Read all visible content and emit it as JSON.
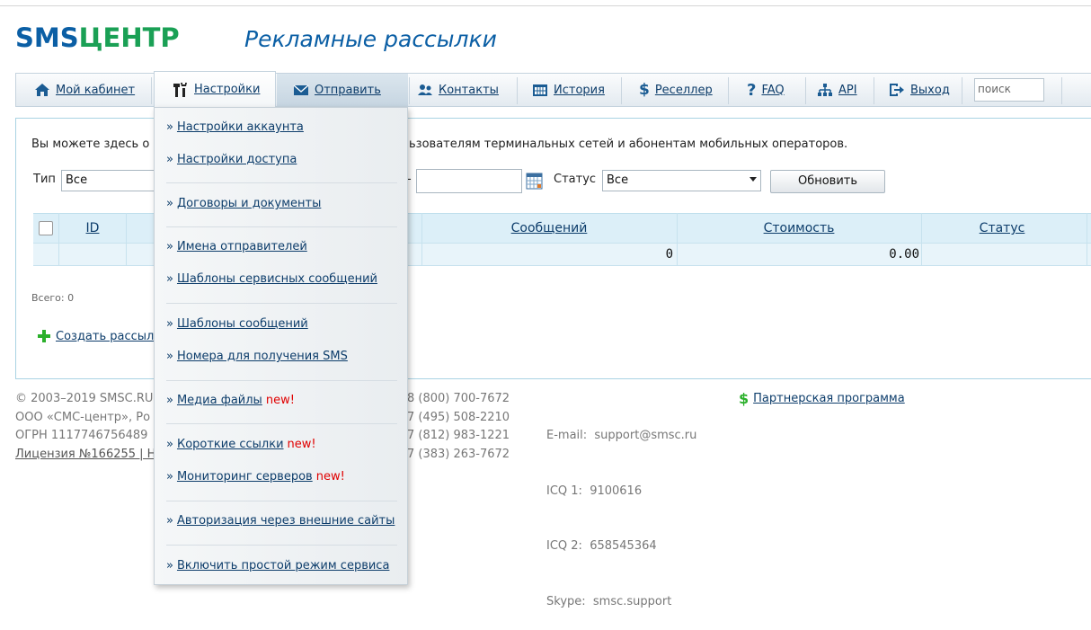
{
  "logo": {
    "part1": "SMS",
    "part2": "ЦЕНТР"
  },
  "page_title": "Рекламные рассылки",
  "nav": {
    "items": [
      {
        "label": "Мой кабинет",
        "icon": "home-icon"
      },
      {
        "label": "Настройки",
        "icon": "tools-icon"
      },
      {
        "label": "Отправить",
        "icon": "envelope-icon"
      },
      {
        "label": "Контакты",
        "icon": "contacts-icon"
      },
      {
        "label": "История",
        "icon": "calendar-icon"
      },
      {
        "label": "Реселлер",
        "icon": "dollar-icon"
      },
      {
        "label": "FAQ",
        "icon": "question-icon"
      },
      {
        "label": "API",
        "icon": "sitemap-icon"
      },
      {
        "label": "Выход",
        "icon": "exit-icon"
      }
    ],
    "search_placeholder": "поиск"
  },
  "main": {
    "intro_left": "Вы можете здесь о",
    "intro_right": "ьзователям терминальных сетей и абонентам мобильных операторов.",
    "filter_type_label": "Тип",
    "filter_type_value": "Все",
    "filter_dash": "-",
    "filter_status_label": "Статус",
    "filter_status_value": "Все",
    "refresh_button": "Обновить",
    "table": {
      "headers": [
        "ID",
        "Сообщений",
        "Стоимость",
        "Статус"
      ],
      "row": {
        "messages": "0",
        "cost": "0.00"
      }
    },
    "total": "Всего: 0",
    "create_link": "Создать рассыл"
  },
  "footer": {
    "col1": [
      "© 2003–2019 SMSC.RU",
      "ООО «СМС-центр», Ро",
      "ОГРН 1117746756489",
      "Лицензия №166255 | Н"
    ],
    "col2": [
      "8 (800) 700-7672",
      "7 (495) 508-2210",
      "7 (812) 983-1221",
      "7 (383) 263-7672"
    ],
    "col3": [
      "E-mail:  support@smsc.ru",
      "ICQ 1:  9100616",
      "ICQ 2:  658545364",
      "Skype:  smsc.support"
    ],
    "partner_link": "Партнерская программа"
  },
  "dropdown": {
    "items": [
      {
        "label": "Настройки аккаунта",
        "new": ""
      },
      {
        "label": "Настройки доступа",
        "new": ""
      },
      {
        "label": "Договоры и документы",
        "new": ""
      },
      {
        "label": "Имена отправителей",
        "new": ""
      },
      {
        "label": "Шаблоны сервисных сообщений",
        "new": ""
      },
      {
        "label": "Шаблоны сообщений",
        "new": ""
      },
      {
        "label": "Номера для получения SMS",
        "new": ""
      },
      {
        "label": "Медиа файлы",
        "new": "new!"
      },
      {
        "label": "Короткие ссылки",
        "new": "new!"
      },
      {
        "label": "Мониторинг серверов",
        "new": "new!"
      },
      {
        "label": "Авторизация через внешние сайты",
        "new": ""
      },
      {
        "label": "Включить простой режим сервиса",
        "new": ""
      }
    ],
    "bullet": "»"
  }
}
